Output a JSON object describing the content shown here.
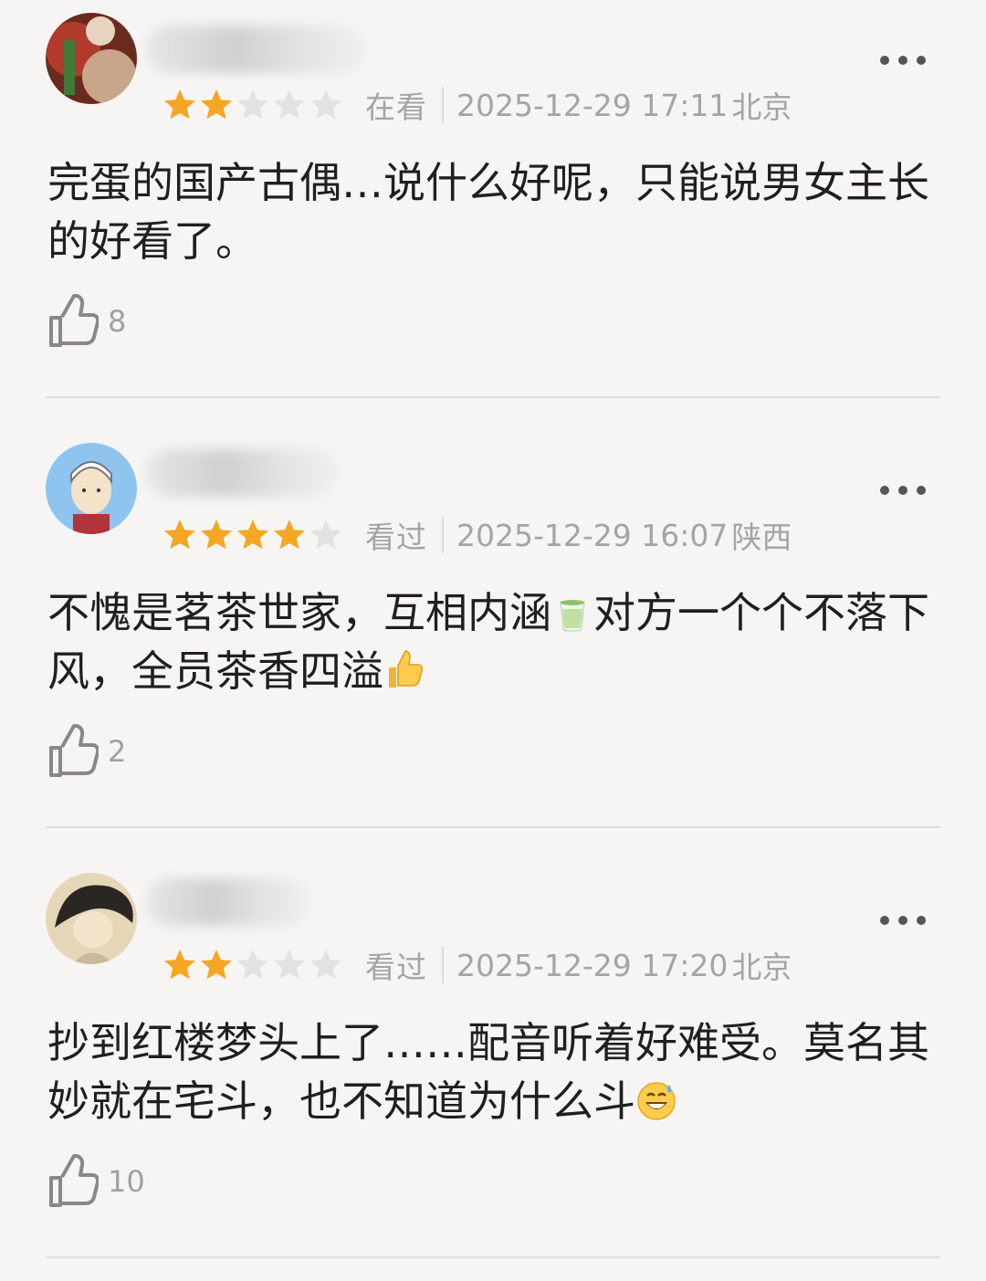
{
  "reviews": [
    {
      "rating": 2,
      "status": "在看",
      "date": "2025-12-29 17:11",
      "location": "北京",
      "content": "完蛋的国产古偶…说什么好呢，只能说男女主长的好看了。",
      "emoji": "",
      "likes": "8"
    },
    {
      "rating": 4,
      "status": "看过",
      "date": "2025-12-29 16:07",
      "location": "陕西",
      "content_part1": "不愧是茗茶世家，互相内涵",
      "emoji1": "tea-cup-icon",
      "content_part2": "对方一个个不落下风，全员茶香四溢",
      "emoji2": "thumbs-up-emoji-icon",
      "likes": "2"
    },
    {
      "rating": 2,
      "status": "看过",
      "date": "2025-12-29 17:20",
      "location": "北京",
      "content": "抄到红楼梦头上了……配音听着好难受。莫名其妙就在宅斗，也不知道为什么斗",
      "emoji": "grinning-sweat-emoji-icon",
      "likes": "10"
    }
  ],
  "colors": {
    "star_filled": "#f5a623",
    "star_empty": "#e2e2e2",
    "background": "#f6f5f3"
  }
}
